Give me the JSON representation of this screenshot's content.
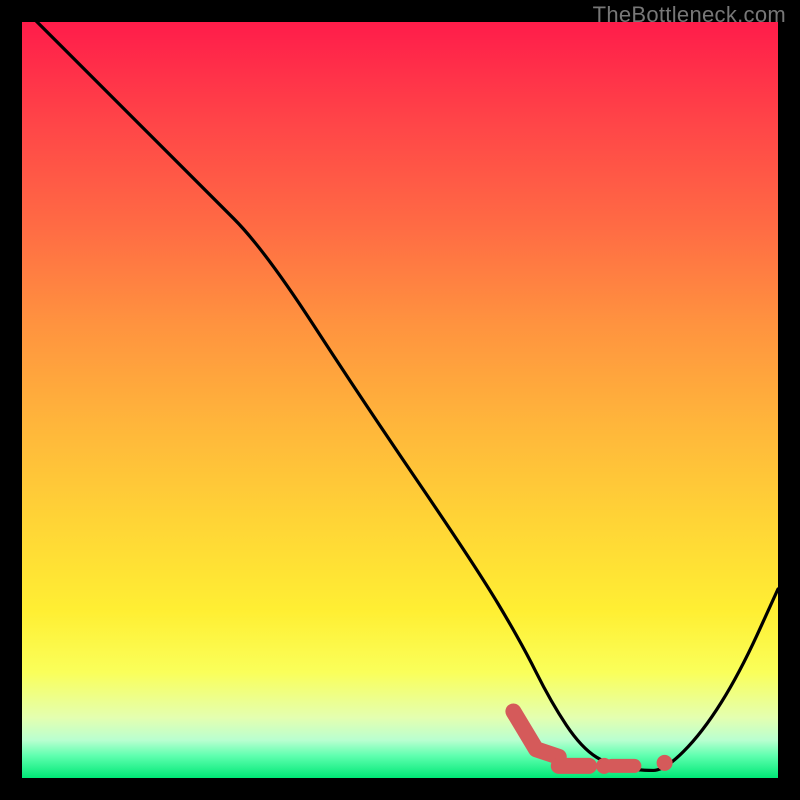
{
  "watermark": "TheBottleneck.com",
  "chart_data": {
    "type": "line",
    "title": "",
    "xlabel": "",
    "ylabel": "",
    "xlim": [
      0,
      100
    ],
    "ylim": [
      0,
      100
    ],
    "series": [
      {
        "name": "curve",
        "x": [
          0,
          10,
          24,
          32,
          45,
          60,
          66,
          70,
          74,
          78,
          82,
          85,
          90,
          95,
          100
        ],
        "values": [
          102,
          92,
          78,
          70,
          50,
          28,
          18,
          10,
          4,
          1.5,
          1,
          1,
          6,
          14,
          25
        ]
      }
    ],
    "markers": [
      {
        "name": "valley-segment",
        "x_start": 65,
        "x_end": 71,
        "y": 2.8,
        "style": "thick"
      },
      {
        "name": "valley-flat",
        "x_start": 71,
        "x_end": 75,
        "y": 1.6,
        "style": "thick-flat"
      },
      {
        "name": "valley-dot-1",
        "x": 77,
        "y": 1.6
      },
      {
        "name": "valley-dash",
        "x_start": 78,
        "x_end": 81,
        "y": 1.6,
        "style": "short"
      },
      {
        "name": "valley-dot-2",
        "x": 85,
        "y": 2.0
      }
    ],
    "colors": {
      "curve": "#000000",
      "marker": "#d55a5a"
    }
  }
}
